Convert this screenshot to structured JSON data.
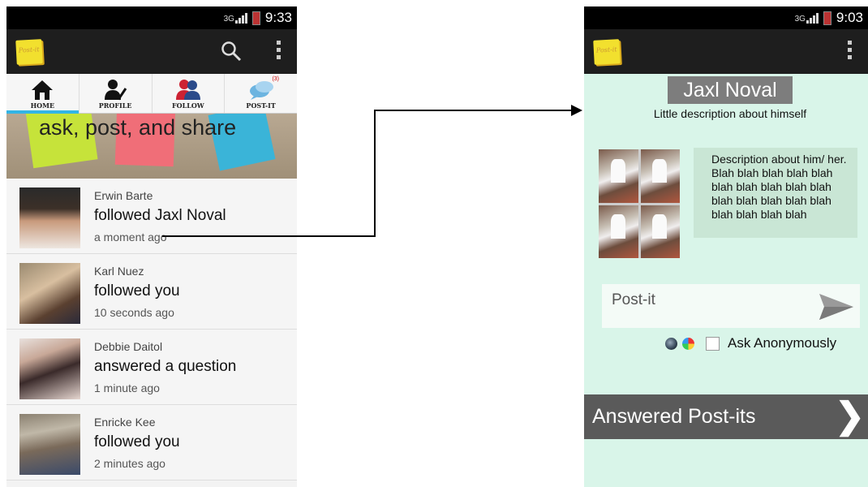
{
  "left": {
    "status": {
      "time": "9:33",
      "network": "3G"
    },
    "tabs": [
      {
        "label": "HOME",
        "icon": "home-icon"
      },
      {
        "label": "PROFILE",
        "icon": "profile-icon"
      },
      {
        "label": "FOLLOW",
        "icon": "follow-icon"
      },
      {
        "label": "POST-IT",
        "icon": "post-it-icon",
        "badge": "(3)"
      }
    ],
    "banner_text": "ask, post, and share",
    "feed": [
      {
        "name": "Erwin Barte",
        "action": "followed Jaxl Noval",
        "time": "a moment ago"
      },
      {
        "name": "Karl Nuez",
        "action": "followed you",
        "time": "10 seconds ago"
      },
      {
        "name": "Debbie Daitol",
        "action": "answered a question",
        "time": "1 minute ago"
      },
      {
        "name": "Enricke Kee",
        "action": "followed you",
        "time": "2 minutes ago"
      }
    ]
  },
  "right": {
    "status": {
      "time": "9:03",
      "network": "3G"
    },
    "profile": {
      "name": "Jaxl Noval",
      "tagline": "Little description about himself",
      "bio": "Description about him/ her. Blah blah blah blah blah blah blah blah blah blah blah blah blah blah blah blah blah blah blah"
    },
    "postit_placeholder": "Post-it",
    "ask_anonymously_label": "Ask Anonymously",
    "answered_section_label": "Answered Post-its"
  },
  "logo_text": "Post-it",
  "colors": {
    "actionbar": "#1e1e1e",
    "tab_indicator": "#33b5e5",
    "profile_background": "#d9f5e9",
    "answered_bar": "#5a5a5a"
  }
}
